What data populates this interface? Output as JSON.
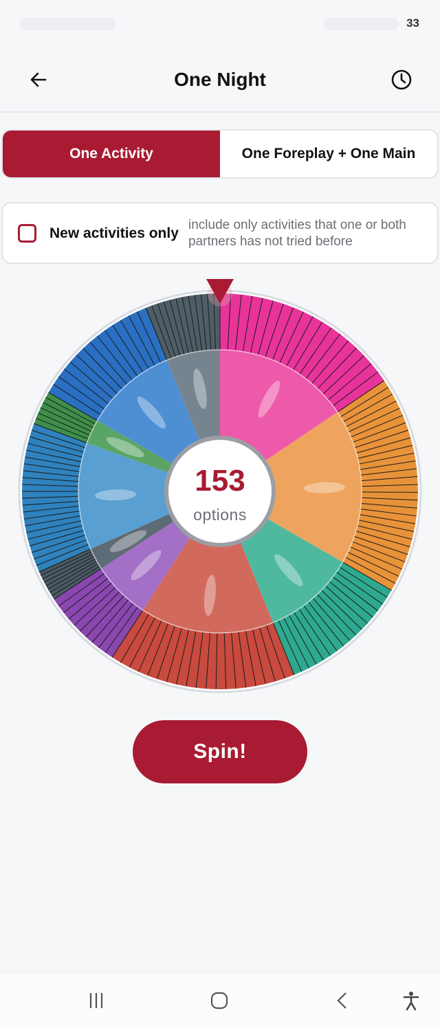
{
  "status_bar": {
    "battery": "33"
  },
  "header": {
    "title": "One Night",
    "back_icon": "arrow-left-icon",
    "history_icon": "clock-icon"
  },
  "mode_tabs": [
    {
      "label": "One Activity",
      "selected": true
    },
    {
      "label": "One Foreplay + One Main",
      "selected": false
    }
  ],
  "filter": {
    "label": "New activities only",
    "description": "include only activities that one or both partners has not tried before",
    "checked": false
  },
  "wheel": {
    "count": "153",
    "count_label": "options",
    "pointer_icon": "triangle-down-icon",
    "categories": [
      {
        "color": "#e8339a",
        "inner": "#ee5aaa",
        "start": 0,
        "end": 56,
        "ticks": 18
      },
      {
        "color": "#e8923a",
        "inner": "#eea45e",
        "start": 56,
        "end": 120,
        "ticks": 28
      },
      {
        "color": "#2ea98f",
        "inner": "#4fb9a0",
        "start": 120,
        "end": 158,
        "ticks": 16
      },
      {
        "color": "#c94a3e",
        "inner": "#d16a5d",
        "start": 158,
        "end": 213,
        "ticks": 19
      },
      {
        "color": "#8a47b0",
        "inner": "#a46fc7",
        "start": 213,
        "end": 237,
        "ticks": 10
      },
      {
        "color": "#4a5a66",
        "inner": "#5d6b76",
        "start": 237,
        "end": 246,
        "ticks": 8
      },
      {
        "color": "#2f82bd",
        "inner": "#5a9fd1",
        "start": 246,
        "end": 290,
        "ticks": 22
      },
      {
        "color": "#3f8f4a",
        "inner": "#5aa565",
        "start": 290,
        "end": 300,
        "ticks": 6
      },
      {
        "color": "#2a6fc2",
        "inner": "#4e8fd4",
        "start": 300,
        "end": 338,
        "ticks": 14
      },
      {
        "color": "#4f5d66",
        "inner": "#76848f",
        "start": 338,
        "end": 360,
        "ticks": 12
      }
    ]
  },
  "spin_button": {
    "label": "Spin!"
  },
  "nav_bar": {
    "items": [
      "recent-apps-icon",
      "home-icon",
      "back-icon",
      "accessibility-icon"
    ]
  },
  "colors": {
    "accent": "#a81b32",
    "background": "#f6f7f9"
  }
}
